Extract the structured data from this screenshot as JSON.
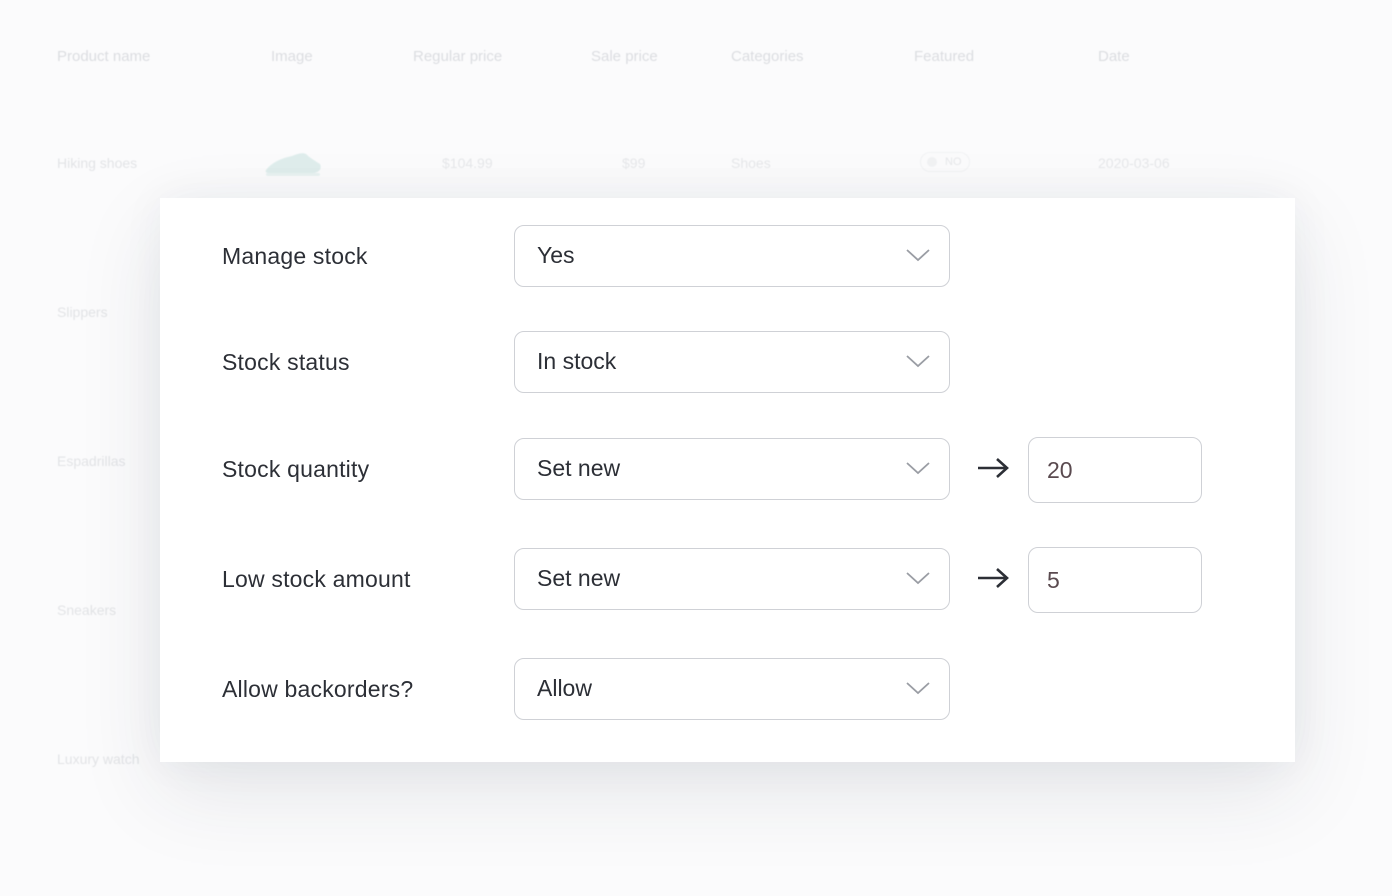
{
  "background_table": {
    "headers": [
      "Product name",
      "Image",
      "Regular price",
      "Sale price",
      "Categories",
      "Featured",
      "Date"
    ],
    "rows": [
      {
        "name": "Hiking shoes",
        "regular_price": "$104.99",
        "sale_price": "$99",
        "category": "Shoes",
        "featured": "NO",
        "date": "2020-03-06"
      },
      {
        "name": "Slippers"
      },
      {
        "name": "Espadrillas"
      },
      {
        "name": "Sneakers"
      },
      {
        "name": "Luxury watch"
      }
    ]
  },
  "form": {
    "manage_stock": {
      "label": "Manage stock",
      "value": "Yes"
    },
    "stock_status": {
      "label": "Stock status",
      "value": "In stock"
    },
    "stock_quantity": {
      "label": "Stock quantity",
      "mode": "Set new",
      "amount": "20"
    },
    "low_stock_amount": {
      "label": "Low stock amount",
      "mode": "Set new",
      "amount": "5"
    },
    "allow_backorders": {
      "label": "Allow backorders?",
      "value": "Allow"
    }
  },
  "icons": {
    "select_indicator": "chevron-down-icon",
    "value_arrow": "arrow-right-icon"
  },
  "colors": {
    "text": "#2c2f36",
    "border": "#cfd1d6",
    "chevron": "#9a9da4"
  }
}
